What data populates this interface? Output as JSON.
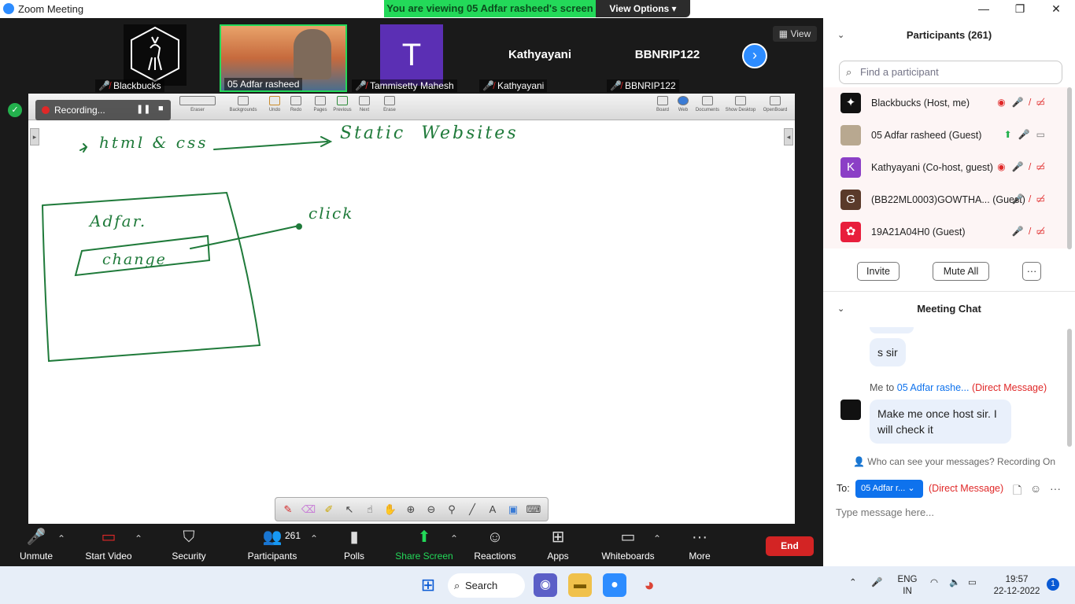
{
  "window": {
    "title": "Zoom Meeting",
    "minimize": "—",
    "restore": "❐",
    "close": "✕"
  },
  "banner": {
    "viewing": "You are viewing 05 Adfar rasheed's screen",
    "view_options": "View Options ▾"
  },
  "gallery": {
    "view_label": "View",
    "tiles": [
      {
        "name": "Blackbucks",
        "muted": true
      },
      {
        "name": "05 Adfar rasheed",
        "muted": false
      },
      {
        "name": "Tammisetty Mahesh",
        "muted": true,
        "initial": "T"
      },
      {
        "name": "Kathyayani",
        "muted": true,
        "big": "Kathyayani"
      },
      {
        "name": "BBNRIP122",
        "muted": true,
        "big": "BBNRIP122"
      }
    ],
    "next_icon": "›"
  },
  "recording": {
    "label": "Recording...",
    "pause": "❚❚",
    "stop": "■"
  },
  "whiteboard_toolbar": {
    "items": [
      "Eraser",
      "Backgrounds",
      "Undo",
      "Redo",
      "Pages",
      "Previous",
      "Next",
      "Erase"
    ],
    "right_items": [
      "Board",
      "Web",
      "Documents",
      "Show Desktop",
      "OpenBoard"
    ]
  },
  "controls": {
    "unmute": "Unmute",
    "start_video": "Start Video",
    "security": "Security",
    "participants": "Participants",
    "participant_count": "261",
    "polls": "Polls",
    "share_screen": "Share Screen",
    "reactions": "Reactions",
    "apps": "Apps",
    "whiteboards": "Whiteboards",
    "more": "More",
    "end": "End"
  },
  "participants_panel": {
    "title": "Participants (261)",
    "search_placeholder": "Find a participant",
    "rows": [
      {
        "name": "Blackbucks (Host, me)",
        "avatar_color": "#111111",
        "avatar_letter": ""
      },
      {
        "name": "05 Adfar rasheed (Guest)",
        "avatar_color": "#b8a890",
        "avatar_letter": ""
      },
      {
        "name": "Kathyayani (Co-host, guest)",
        "avatar_color": "#8b3fc6",
        "avatar_letter": "K"
      },
      {
        "name": "(BB22ML0003)GOWTHA... (Guest)",
        "avatar_color": "#5a3a2a",
        "avatar_letter": "G"
      },
      {
        "name": "19A21A04H0 (Guest)",
        "avatar_color": "#e81e3c",
        "avatar_letter": ""
      }
    ],
    "invite": "Invite",
    "mute_all": "Mute All",
    "more": "···"
  },
  "chat_panel": {
    "title": "Meeting Chat",
    "prev_message": "s sir",
    "meta_prefix": "Me to",
    "meta_to": "05 Adfar rashe...",
    "meta_dm": "(Direct Message)",
    "message": "Make me once host sir. I will check it",
    "who_can_see": "Who can see your messages? Recording On",
    "to_label": "To:",
    "to_chip": "05 Adfar r... ⌄",
    "to_dm": "(Direct Message)",
    "input_placeholder": "Type message here..."
  },
  "taskbar": {
    "search": "Search",
    "lang_1": "ENG",
    "lang_2": "IN",
    "time": "19:57",
    "date": "22-12-2022",
    "notifications": "1"
  },
  "colors": {
    "zoom_blue": "#2d8cff",
    "banner_green": "#23d959",
    "end_red": "#d32424",
    "mute_red": "#e02828",
    "ink_green": "#1f7a3a"
  }
}
